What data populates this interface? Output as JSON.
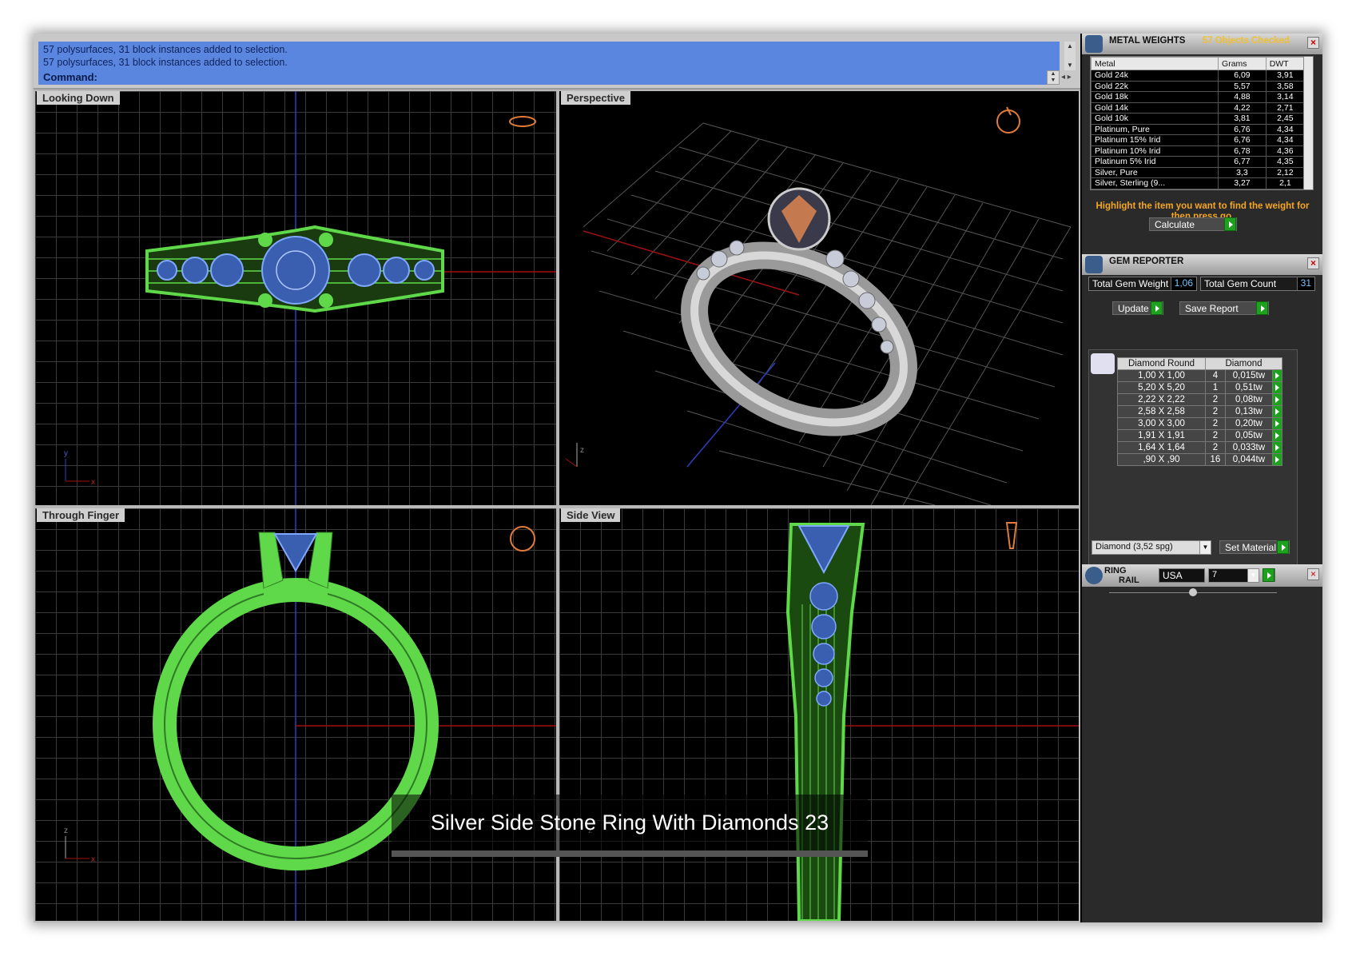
{
  "command": {
    "history": [
      "57 polysurfaces, 31 block instances added to selection.",
      "57 polysurfaces, 31 block instances added to selection."
    ],
    "prompt": "Command:"
  },
  "viewports": {
    "top": "Looking Down",
    "perspective": "Perspective",
    "front": "Through Finger",
    "side": "Side View"
  },
  "axes": {
    "x": "x",
    "y": "y",
    "z": "z"
  },
  "metal_weights": {
    "title": "METAL WEIGHTS",
    "subtitle": "57 Objects Checked",
    "columns": [
      "Metal",
      "Grams",
      "DWT"
    ],
    "rows": [
      [
        "Gold 24k",
        "6,09",
        "3,91"
      ],
      [
        "Gold 22k",
        "5,57",
        "3,58"
      ],
      [
        "Gold 18k",
        "4,88",
        "3,14"
      ],
      [
        "Gold 14k",
        "4,22",
        "2,71"
      ],
      [
        "Gold 10k",
        "3,81",
        "2,45"
      ],
      [
        "Platinum, Pure",
        "6,76",
        "4,34"
      ],
      [
        "Platinum 15% Irid",
        "6,76",
        "4,34"
      ],
      [
        "Platinum 10% Irid",
        "6,78",
        "4,36"
      ],
      [
        "Platinum 5% Irid",
        "6,77",
        "4,35"
      ],
      [
        "Silver, Pure",
        "3,3",
        "2,12"
      ],
      [
        "Silver, Sterling (9...",
        "3,27",
        "2,1"
      ]
    ],
    "hint": "Highlight the item you want to find the weight for then press go.",
    "calculate": "Calculate"
  },
  "gem_reporter": {
    "title": "GEM REPORTER",
    "total_weight_label": "Total Gem Weight",
    "total_weight": "1,06",
    "total_count_label": "Total Gem Count",
    "total_count": "31",
    "update": "Update",
    "save_report": "Save Report",
    "columns": [
      "Diamond Round",
      "Diamond"
    ],
    "rows": [
      [
        "1,00 X 1,00",
        "4",
        "0,015tw"
      ],
      [
        "5,20 X 5,20",
        "1",
        "0,51tw"
      ],
      [
        "2,22 X 2,22",
        "2",
        "0,08tw"
      ],
      [
        "2,58 X 2,58",
        "2",
        "0,13tw"
      ],
      [
        "3,00 X 3,00",
        "2",
        "0,20tw"
      ],
      [
        "1,91 X 1,91",
        "2",
        "0,05tw"
      ],
      [
        "1,64 X 1,64",
        "2",
        "0,033tw"
      ],
      [
        ",90 X ,90",
        "16",
        "0,044tw"
      ]
    ],
    "material": "Diamond    (3,52 spg)",
    "set_material": "Set Material"
  },
  "ring_rail": {
    "title": "RING RAIL",
    "title_line1": "RING",
    "title_line2": "RAIL",
    "country": "USA",
    "size": "7"
  },
  "caption": "Silver Side Stone Ring With Diamonds 23",
  "colors": {
    "wire_green": "#5fd94a",
    "wire_blue": "#7fa8ff",
    "command_blue": "#5a86e0",
    "accent_orange": "#f5a623"
  }
}
